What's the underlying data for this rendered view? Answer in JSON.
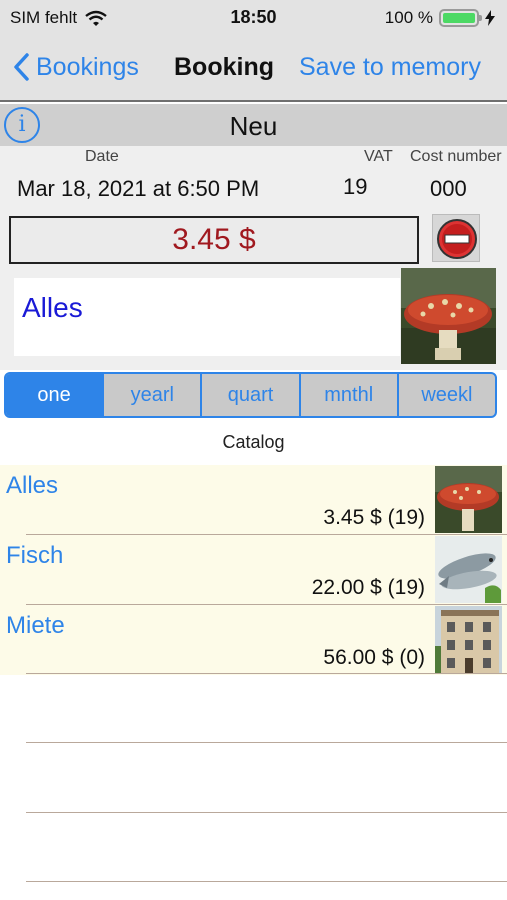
{
  "status_bar": {
    "carrier": "SIM fehlt",
    "time": "18:50",
    "battery_percent": "100 %",
    "battery_level": 1.0,
    "icons": [
      "wifi-icon",
      "battery-icon",
      "charging-bolt-icon"
    ]
  },
  "nav": {
    "back_label": "Bookings",
    "title": "Booking",
    "save_label": "Save to memory"
  },
  "section": {
    "title": "Neu",
    "info_glyph": "i"
  },
  "form": {
    "date_label": "Date",
    "date_value": "Mar 18, 2021 at 6:50 PM",
    "vat_label": "VAT",
    "vat_value": "19",
    "cost_number_label": "Cost number",
    "cost_number_value": "000",
    "amount": "3.45 $",
    "category": "Alles",
    "category_image": "mushroom-photo"
  },
  "frequency": {
    "options": [
      "one",
      "yearl",
      "quart",
      "mnthl",
      "weekl"
    ],
    "selected": "one"
  },
  "catalog": {
    "title": "Catalog",
    "items": [
      {
        "name": "Alles",
        "price": "3.45 $ (19)",
        "image": "mushroom-photo"
      },
      {
        "name": "Fisch",
        "price": "22.00 $ (19)",
        "image": "fish-photo"
      },
      {
        "name": "Miete",
        "price": "56.00 $ (0)",
        "image": "building-photo"
      }
    ]
  },
  "colors": {
    "accent": "#2e84e8",
    "amount_text": "#a0191f",
    "category_text": "#1a1ad6",
    "row_background": "#fdfbe8",
    "nav_background": "#e3e3e3"
  }
}
